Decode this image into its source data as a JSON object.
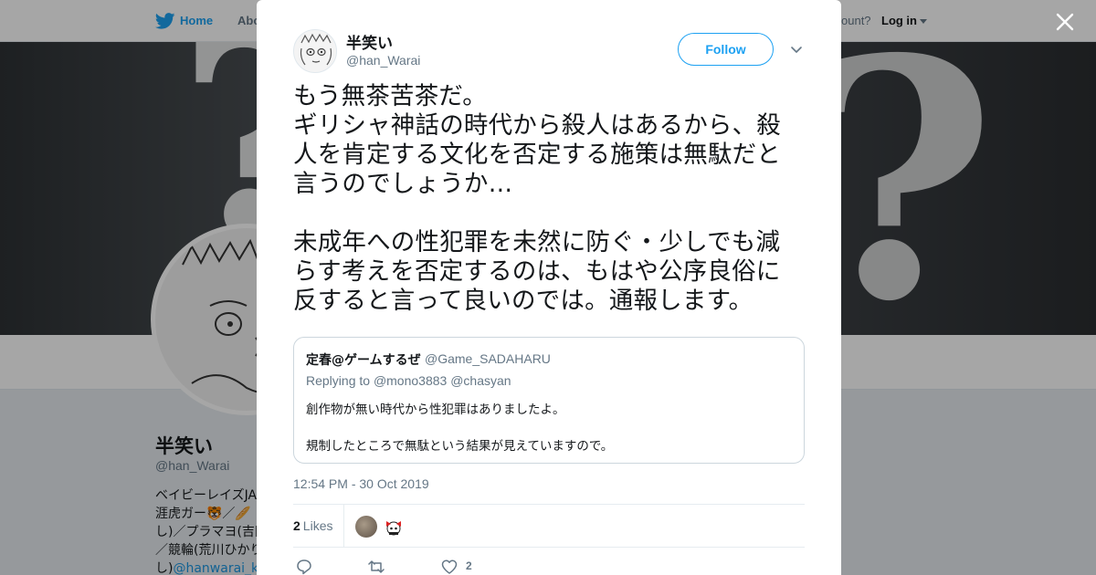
{
  "topnav": {
    "home_label": "Home",
    "about_label": "Abo",
    "have_account_label": "ccount?",
    "login_label": "Log in"
  },
  "profile_bg": {
    "name": "半笑い",
    "handle": "@han_Warai",
    "bio_lines": [
      "ベイビーレイズJA",
      "涯虎ガー🐯／🥖",
      "し)／プラマヨ(吉田",
      "／競輪(荒川ひかり",
      "し)"
    ],
    "bio_link": "@hanwarai_ke"
  },
  "tweet": {
    "display_name": "半笑い",
    "screen_name": "@han_Warai",
    "follow_label": "Follow",
    "text_lines": [
      "もう無茶苦茶だ。",
      "ギリシャ神話の時代から殺人はあるから、殺",
      "人を肯定する文化を否定する施策は無駄だと",
      "言うのでしょうか…",
      "",
      "未成年への性犯罪を未然に防ぐ・少しでも減",
      "らす考えを否定するのは、もはや公序良俗に",
      "反すると言って良いのでは。通報します。"
    ],
    "timestamp": "12:54 PM - 30 Oct 2019",
    "likes_count": "2",
    "likes_label": "Likes",
    "action_like_count": "2"
  },
  "quoted": {
    "name": "定春@ゲームするぜ",
    "handle": "@Game_SADAHARU",
    "replying_prefix": "Replying to",
    "reply_mention_1": "@mono3883",
    "reply_mention_2": "@chasyan",
    "line1": "創作物が無い時代から性犯罪はありましたよ。",
    "line2": "規制したところで無駄という結果が見えていますので。"
  },
  "colors": {
    "accent": "#1da1f2",
    "text": "#14171a",
    "muted": "#657786",
    "border": "#e6ecf0"
  },
  "icons": [
    "twitter-bird-icon",
    "close-icon",
    "chevron-down-icon",
    "reply-icon",
    "retweet-icon",
    "heart-icon"
  ]
}
